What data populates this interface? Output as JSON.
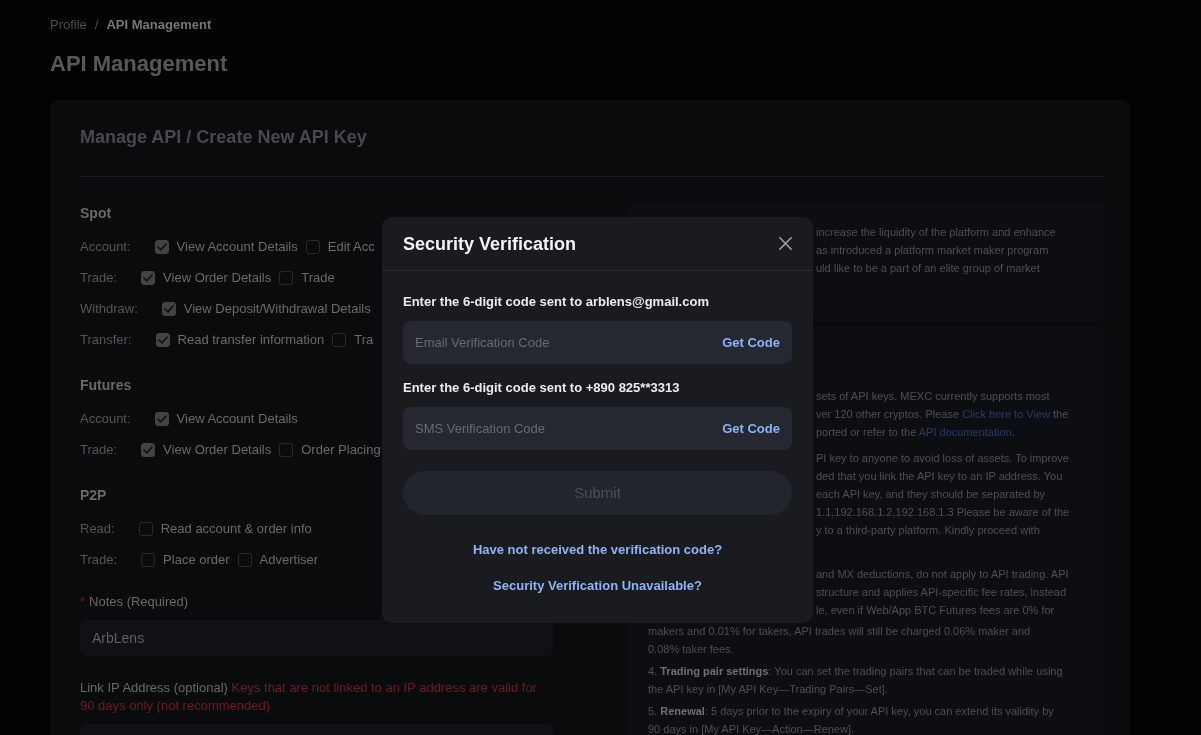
{
  "breadcrumb": {
    "separator": "/",
    "items": [
      {
        "label": "Profile",
        "current": false
      },
      {
        "label": "API Management",
        "current": true
      }
    ]
  },
  "page_title": "API Management",
  "card": {
    "title": "Manage API / Create New API Key"
  },
  "permission_groups": [
    {
      "title": "Spot",
      "rows": [
        {
          "label": "Account:",
          "options": [
            {
              "label": "View Account Details",
              "checked": true
            },
            {
              "label": "Edit Acc",
              "checked": false
            }
          ]
        },
        {
          "label": "Trade:",
          "options": [
            {
              "label": "View Order Details",
              "checked": true
            },
            {
              "label": "Trade",
              "checked": false
            }
          ]
        },
        {
          "label": "Withdraw:",
          "options": [
            {
              "label": "View Deposit/Withdrawal Details",
              "checked": true
            }
          ]
        },
        {
          "label": "Transfer:",
          "options": [
            {
              "label": "Read transfer information",
              "checked": true
            },
            {
              "label": "Tra",
              "checked": false
            }
          ]
        }
      ]
    },
    {
      "title": "Futures",
      "rows": [
        {
          "label": "Account:",
          "options": [
            {
              "label": "View Account Details",
              "checked": true
            }
          ]
        },
        {
          "label": "Trade:",
          "options": [
            {
              "label": "View Order Details",
              "checked": true
            },
            {
              "label": "Order Placing",
              "checked": false
            }
          ]
        }
      ]
    },
    {
      "title": "P2P",
      "rows": [
        {
          "label": "Read:",
          "options": [
            {
              "label": "Read account & order info",
              "checked": false
            }
          ]
        },
        {
          "label": "Trade:",
          "options": [
            {
              "label": "Place order",
              "checked": false
            },
            {
              "label": "Advertiser",
              "checked": false
            }
          ]
        }
      ]
    }
  ],
  "notes": {
    "required_mark": "*",
    "label": "Notes (Required)",
    "value": "ArbLens"
  },
  "ip_address": {
    "label": "Link IP Address (optional)",
    "warning": "Keys that are not linked to an IP address are valid for 90 days only (not recommended)"
  },
  "notice_panel": {
    "lines": [
      "increase the liquidity of the platform and enhance",
      "as introduced a platform market maker program",
      "uld like to be a part of an elite group of market"
    ]
  },
  "guide_panel": {
    "paragraphs": [
      {
        "lines": [
          [
            {
              "kind": "text",
              "text": "sets of API keys. MEXC currently supports most"
            }
          ],
          [
            {
              "kind": "text",
              "text": "ver 120 other cryptos. Please "
            },
            {
              "kind": "link",
              "text": "Click here to View"
            },
            {
              "kind": "text",
              "text": " the"
            }
          ],
          [
            {
              "kind": "text",
              "text": "ported or refer to the "
            },
            {
              "kind": "link",
              "text": "API documentation"
            },
            {
              "kind": "text",
              "text": "."
            }
          ]
        ]
      },
      {
        "lines": [
          [
            {
              "kind": "text",
              "text": "PI key to anyone to avoid loss of assets. To improve"
            }
          ],
          [
            {
              "kind": "text",
              "text": "ded that you link the API key to an IP address. You"
            }
          ],
          [
            {
              "kind": "text",
              "text": "each API key, and they should be separated by"
            }
          ],
          [
            {
              "kind": "text",
              "text": "1.1,192.168.1.2,192.168.1.3 Please be aware of the"
            }
          ],
          [
            {
              "kind": "text",
              "text": "y to a third-party platform. Kindly proceed with"
            }
          ]
        ]
      },
      {
        "lines": [
          [
            {
              "kind": "text",
              "text": "and MX deductions, do not apply to API trading. API"
            }
          ],
          [
            {
              "kind": "text",
              "text": "structure and applies API-specific fee rates, instead"
            }
          ],
          [
            {
              "kind": "text",
              "text": "le, even if Web/App BTC Futures fees are 0% for"
            }
          ]
        ],
        "continued": "makers and 0.01% for takers, API trades will still be charged 0.06% maker and 0.08% taker fees."
      },
      {
        "text": "4. **Trading pair settings**: You can set the trading pairs that can be traded while using the API key in [My API Key—Trading Pairs—Set]."
      },
      {
        "text": "5. **Renewal**: 5 days prior to the expiry of your API key, you can extend its validity by 90 days in [My API Key—Action—Renew]."
      }
    ]
  },
  "dialog": {
    "title": "Security Verification",
    "fields": [
      {
        "prompt": "Enter the 6-digit code sent to arblens@gmail.com",
        "placeholder": "Email Verification Code",
        "action": "Get Code"
      },
      {
        "prompt": "Enter the 6-digit code sent to +890 825**3313",
        "placeholder": "SMS Verification Code",
        "action": "Get Code"
      }
    ],
    "submit": {
      "label": "Submit",
      "disabled": true
    },
    "help_links": [
      "Have not received the verification code?",
      "Security Verification Unavailable?"
    ]
  }
}
